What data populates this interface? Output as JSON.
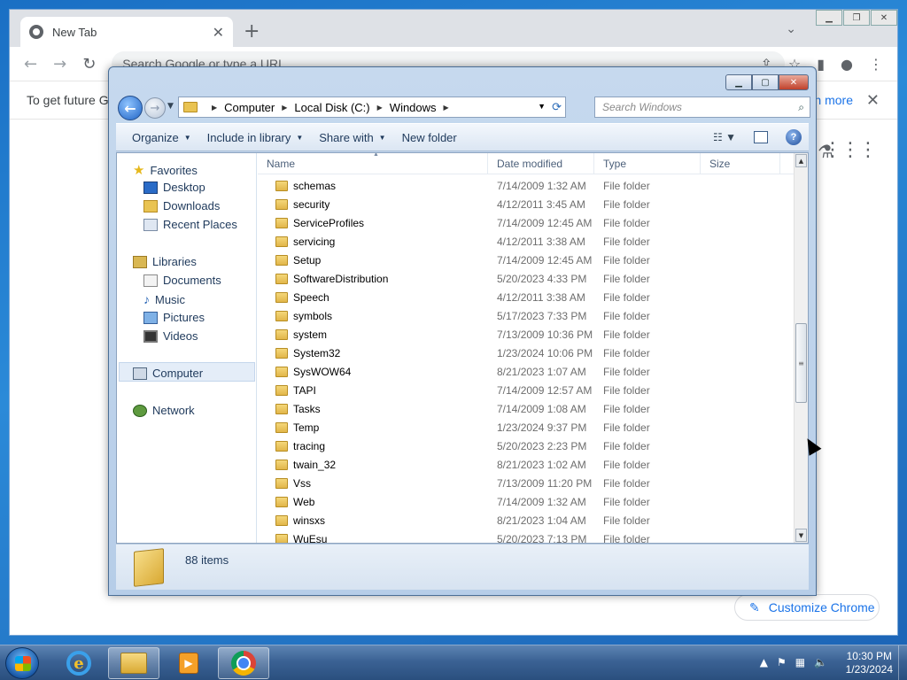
{
  "chrome": {
    "tab_title": "New Tab",
    "tab_close": "✕",
    "new_tab": "+",
    "omnibox_placeholder": "Search Google or type a URL",
    "infobar_text": "To get future Go",
    "infobar_link": "n more",
    "infobar_close": "✕",
    "customize_label": "Customize Chrome"
  },
  "explorer": {
    "breadcrumb": [
      "Computer",
      "Local Disk (C:)",
      "Windows"
    ],
    "search_placeholder": "Search Windows",
    "commands": {
      "organize": "Organize",
      "include_in_library": "Include in library",
      "share_with": "Share with",
      "new_folder": "New folder"
    },
    "nav": {
      "favorites": "Favorites",
      "desktop": "Desktop",
      "downloads": "Downloads",
      "recent_places": "Recent Places",
      "libraries": "Libraries",
      "documents": "Documents",
      "music": "Music",
      "pictures": "Pictures",
      "videos": "Videos",
      "computer": "Computer",
      "network": "Network"
    },
    "columns": {
      "name": "Name",
      "date_modified": "Date modified",
      "type": "Type",
      "size": "Size"
    },
    "files": [
      {
        "name": "schemas",
        "date": "7/14/2009 1:32 AM",
        "type": "File folder"
      },
      {
        "name": "security",
        "date": "4/12/2011 3:45 AM",
        "type": "File folder"
      },
      {
        "name": "ServiceProfiles",
        "date": "7/14/2009 12:45 AM",
        "type": "File folder"
      },
      {
        "name": "servicing",
        "date": "4/12/2011 3:38 AM",
        "type": "File folder"
      },
      {
        "name": "Setup",
        "date": "7/14/2009 12:45 AM",
        "type": "File folder"
      },
      {
        "name": "SoftwareDistribution",
        "date": "5/20/2023 4:33 PM",
        "type": "File folder"
      },
      {
        "name": "Speech",
        "date": "4/12/2011 3:38 AM",
        "type": "File folder"
      },
      {
        "name": "symbols",
        "date": "5/17/2023 7:33 PM",
        "type": "File folder"
      },
      {
        "name": "system",
        "date": "7/13/2009 10:36 PM",
        "type": "File folder"
      },
      {
        "name": "System32",
        "date": "1/23/2024 10:06 PM",
        "type": "File folder"
      },
      {
        "name": "SysWOW64",
        "date": "8/21/2023 1:07 AM",
        "type": "File folder"
      },
      {
        "name": "TAPI",
        "date": "7/14/2009 12:57 AM",
        "type": "File folder"
      },
      {
        "name": "Tasks",
        "date": "7/14/2009 1:08 AM",
        "type": "File folder"
      },
      {
        "name": "Temp",
        "date": "1/23/2024 9:37 PM",
        "type": "File folder"
      },
      {
        "name": "tracing",
        "date": "5/20/2023 2:23 PM",
        "type": "File folder"
      },
      {
        "name": "twain_32",
        "date": "8/21/2023 1:02 AM",
        "type": "File folder"
      },
      {
        "name": "Vss",
        "date": "7/13/2009 11:20 PM",
        "type": "File folder"
      },
      {
        "name": "Web",
        "date": "7/14/2009 1:32 AM",
        "type": "File folder"
      },
      {
        "name": "winsxs",
        "date": "8/21/2023 1:04 AM",
        "type": "File folder"
      },
      {
        "name": "WuEsu",
        "date": "5/20/2023 7:13 PM",
        "type": "File folder"
      }
    ],
    "item_count": "88 items"
  },
  "taskbar": {
    "time": "10:30 PM",
    "date": "1/23/2024"
  },
  "colors": {
    "chrome_link": "#1a73e8",
    "explorer_text": "#1e395b",
    "folder_yellow": "#e9c352"
  }
}
